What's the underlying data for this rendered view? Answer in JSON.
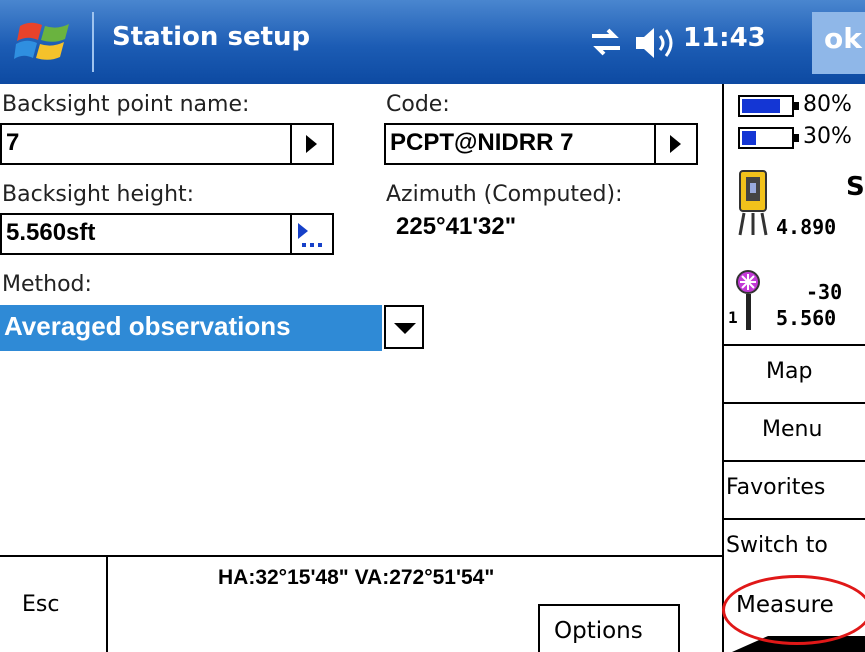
{
  "window": {
    "title": "Station setup",
    "time": "11:43",
    "ok_label": "ok"
  },
  "form": {
    "backsight_point_label": "Backsight point name:",
    "backsight_point_value": "7",
    "code_label": "Code:",
    "code_value": "PCPT@NIDRR 7",
    "backsight_height_label": "Backsight height:",
    "backsight_height_value": "5.560sft",
    "azimuth_label": "Azimuth (Computed):",
    "azimuth_value": "225°41'32\"",
    "method_label": "Method:",
    "method_value": "Averaged observations"
  },
  "status_panel": {
    "battery1_pct": "80%",
    "battery1_level": 0.8,
    "battery2_pct": "30%",
    "battery2_level": 0.3,
    "instrument_letter": "S",
    "instrument_height": "4.890",
    "target_id": "1",
    "target_constant": "-30",
    "target_height": "5.560"
  },
  "side_buttons": [
    "Map",
    "Menu",
    "Favorites",
    "Switch to"
  ],
  "bottom": {
    "esc_label": "Esc",
    "angles": "HA:32°15'48\"  VA:272°51'54\"",
    "options_label": "Options",
    "measure_label": "Measure"
  },
  "colors": {
    "titlebar": "#1c5cb4",
    "selection": "#2f8ad6",
    "battery": "#1436d4",
    "highlight_ellipse": "#e01818"
  }
}
